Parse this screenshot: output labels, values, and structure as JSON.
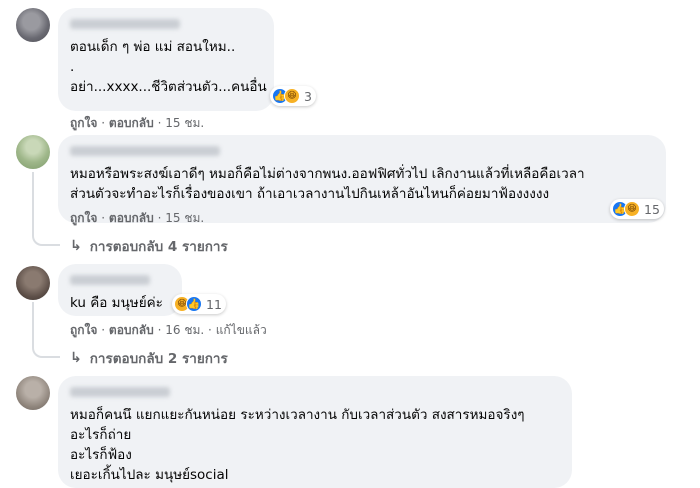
{
  "comments": [
    {
      "lines": [
        "ตอนเด็ก ๆ พ่อ แม่ สอนใหม..",
        ".",
        "อย่า...xxxx...ชีวิตส่วนตัว...คนอื่น"
      ],
      "reaction_count": "3",
      "meta": {
        "like": "ถูกใจ",
        "reply": "ตอบกลับ",
        "time": "15 ชม."
      }
    },
    {
      "lines": [
        "หมอหรือพระสงฆ์เอาดีๆ หมอก็คือไม่ต่างจากพนง.ออฟฟิศทั่วไป เลิกงานแล้วที่เหลือคือเวลา",
        "ส่วนตัวจะทำอะไรก็เรื่องของเขา ถ้าเอาเวลางานไปกินเหล้าอันไหนก็ค่อยมาฟ้องงงงง"
      ],
      "reaction_count": "15",
      "meta": {
        "like": "ถูกใจ",
        "reply": "ตอบกลับ",
        "time": "15 ชม."
      },
      "replies_label": "การตอบกลับ 4 รายการ"
    },
    {
      "lines": [
        "ku คือ มนุษย์ค่ะ"
      ],
      "reaction_count": "11",
      "meta": {
        "like": "ถูกใจ",
        "reply": "ตอบกลับ",
        "time": "16 ชม.",
        "edited": "แก้ไขแล้ว"
      },
      "replies_label": "การตอบกลับ 2 รายการ"
    },
    {
      "lines": [
        "หมอก็คนนึ แยกแยะกันหน่อย ระหว่างเวลางาน กับเวลาส่วนตัว สงสารหมอจริงๆ",
        "อะไรก็ถ่าย",
        "อะไรก็ฟ้อง",
        "เยอะเกิ้นไปละ มนุษย์social"
      ]
    }
  ],
  "separator": "·",
  "colors": {
    "bubble": "#f0f2f5",
    "meta_text": "#65676b",
    "like_blue": "#1877f2",
    "haha_yellow": "#f7b125"
  },
  "icons": {
    "like": "like-reaction-icon",
    "haha": "haha-reaction-icon",
    "reply_arrow": "reply-arrow-icon"
  }
}
